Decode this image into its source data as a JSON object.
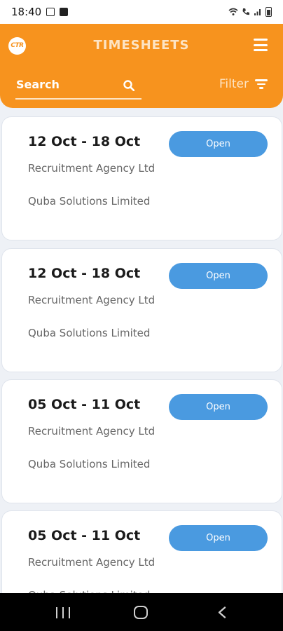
{
  "status_bar": {
    "time": "18:40"
  },
  "header": {
    "logo_text": "CTR",
    "title": "TIMESHEETS",
    "search_label": "Search",
    "filter_label": "Filter"
  },
  "timesheets": [
    {
      "date_range": "12 Oct - 18 Oct",
      "agency": "Recruitment Agency Ltd",
      "company": "Quba Solutions Limited",
      "status_button": "Open"
    },
    {
      "date_range": "12 Oct - 18 Oct",
      "agency": "Recruitment Agency Ltd",
      "company": "Quba Solutions Limited",
      "status_button": "Open"
    },
    {
      "date_range": "05 Oct - 11 Oct",
      "agency": "Recruitment Agency Ltd",
      "company": "Quba Solutions Limited",
      "status_button": "Open"
    },
    {
      "date_range": "05 Oct - 11 Oct",
      "agency": "Recruitment Agency Ltd",
      "company": "Quba Solutions Limited",
      "status_button": "Open"
    }
  ],
  "colors": {
    "header_orange": "#f7931e",
    "button_blue": "#4a9ae0",
    "background": "#eef1f6"
  },
  "icons": {
    "menu": "hamburger-icon",
    "search": "search-icon",
    "filter": "filter-icon",
    "nav_recent": "recent-apps-icon",
    "nav_home": "home-icon",
    "nav_back": "back-icon"
  }
}
